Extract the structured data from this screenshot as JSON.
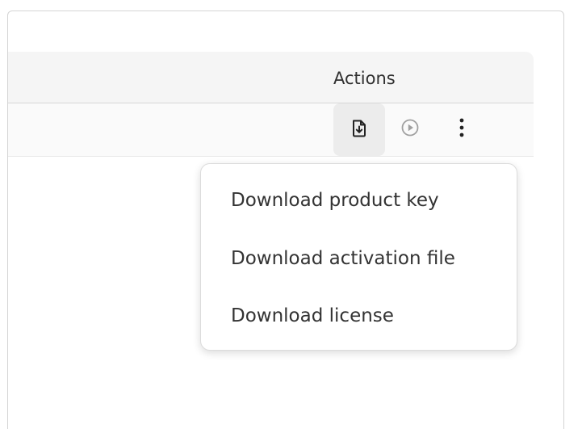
{
  "table": {
    "header": {
      "actions_label": "Actions"
    },
    "row": {
      "actions": {
        "download_icon": "download-file-icon",
        "play_icon": "play-circle-icon",
        "more_icon": "kebab-vertical-icon"
      }
    }
  },
  "menu": {
    "items": [
      {
        "label": "Download product key"
      },
      {
        "label": "Download activation file"
      },
      {
        "label": "Download license"
      }
    ]
  },
  "colors": {
    "header_bg": "#f5f5f5",
    "active_button_bg": "#ececec",
    "text": "#303030",
    "muted_icon": "#a0a0a0"
  }
}
